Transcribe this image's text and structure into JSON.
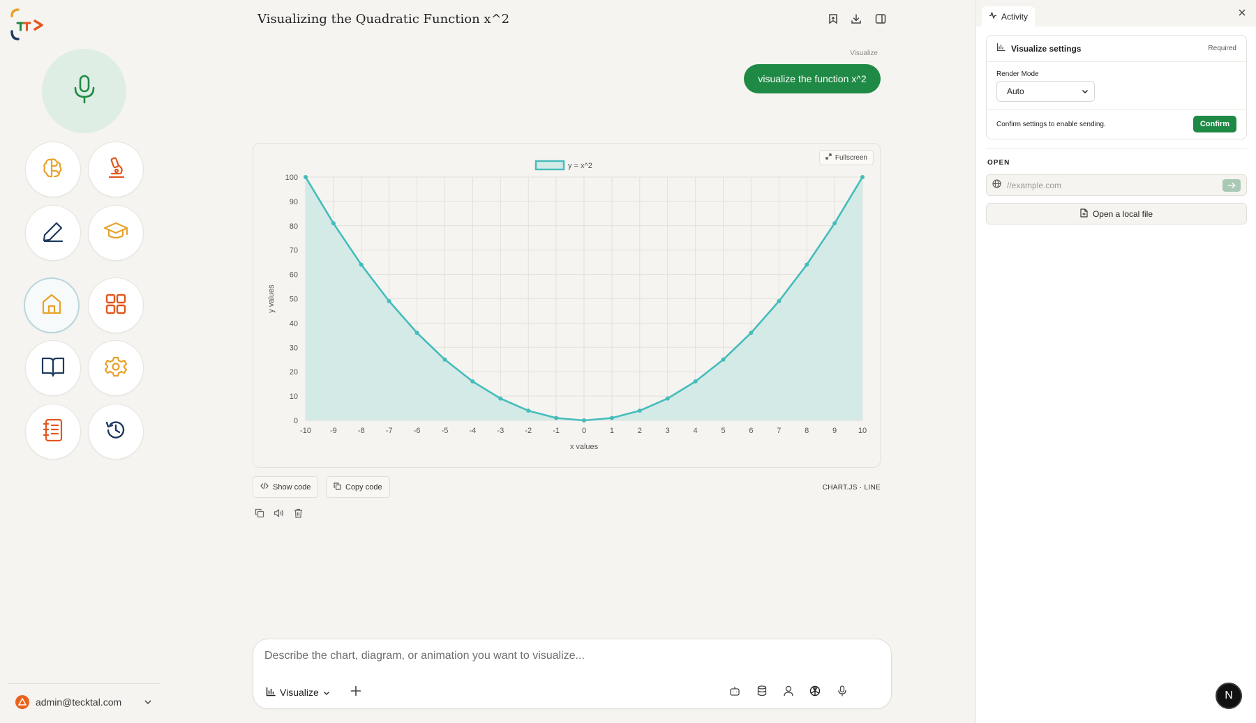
{
  "header": {
    "title": "Visualizing the Quadratic Function x^2"
  },
  "conversation": {
    "mode_label": "Visualize",
    "user_message": "visualize the function x^2"
  },
  "chart_card": {
    "fullscreen_label": "Fullscreen",
    "show_code_label": "Show code",
    "copy_code_label": "Copy code",
    "meta_label": "CHART.JS · LINE"
  },
  "chart_data": {
    "type": "area",
    "x": [
      -10,
      -9,
      -8,
      -7,
      -6,
      -5,
      -4,
      -3,
      -2,
      -1,
      0,
      1,
      2,
      3,
      4,
      5,
      6,
      7,
      8,
      9,
      10
    ],
    "series": [
      {
        "name": "y = x^2",
        "values": [
          100,
          81,
          64,
          49,
          36,
          25,
          16,
          9,
          4,
          1,
          0,
          1,
          4,
          9,
          16,
          25,
          36,
          49,
          64,
          81,
          100
        ],
        "color": "#45bcbb",
        "fill": "#d3eae7"
      }
    ],
    "xlabel": "x values",
    "ylabel": "y values",
    "ylim": [
      0,
      100
    ],
    "yticks": [
      0,
      10,
      20,
      30,
      40,
      50,
      60,
      70,
      80,
      90,
      100
    ],
    "grid": true,
    "legend": "top-center"
  },
  "composer": {
    "placeholder": "Describe the chart, diagram, or animation you want to visualize...",
    "mode": "Visualize"
  },
  "user": {
    "email": "admin@tecktal.com"
  },
  "right_panel": {
    "tab_label": "Activity",
    "settings": {
      "title": "Visualize settings",
      "required_label": "Required",
      "render_mode_label": "Render Mode",
      "render_mode_value": "Auto",
      "confirm_text": "Confirm settings to enable sending.",
      "confirm_button": "Confirm"
    },
    "open": {
      "section_label": "OPEN",
      "url_placeholder": "//example.com",
      "local_file_label": "Open a local file"
    }
  },
  "badge": {
    "letter": "N"
  },
  "colors": {
    "accent_green": "#1f8a45",
    "chart_line": "#45bcbb",
    "chart_fill": "#d3eae7",
    "icon_orange": "#e8a22a",
    "icon_red_orange": "#e2561d",
    "icon_navy": "#1d3a5f"
  }
}
